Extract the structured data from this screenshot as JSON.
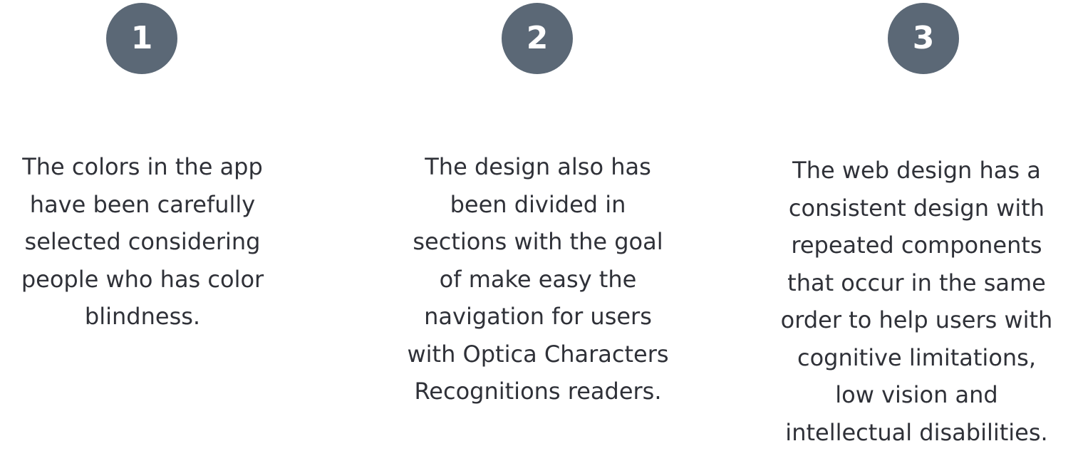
{
  "features": [
    {
      "number": "1",
      "lines": [
        "The colors in the app",
        "have been carefully",
        "selected considering",
        "people who has color",
        "blindness."
      ]
    },
    {
      "number": "2",
      "lines": [
        "The design also has",
        "been divided in",
        "sections with the goal",
        "of make easy the",
        "navigation for users",
        "with Optica Characters",
        "Recognitions readers."
      ]
    },
    {
      "number": "3",
      "lines": [
        "The web design has a",
        "consistent design with",
        "repeated components",
        "that occur in the same",
        "order to help users with",
        "cognitive limitations,",
        "low vision and",
        "intellectual disabilities."
      ]
    }
  ],
  "colors": {
    "badge_background": "#5b6876",
    "badge_text": "#ffffff",
    "body_text": "#2f3138"
  }
}
